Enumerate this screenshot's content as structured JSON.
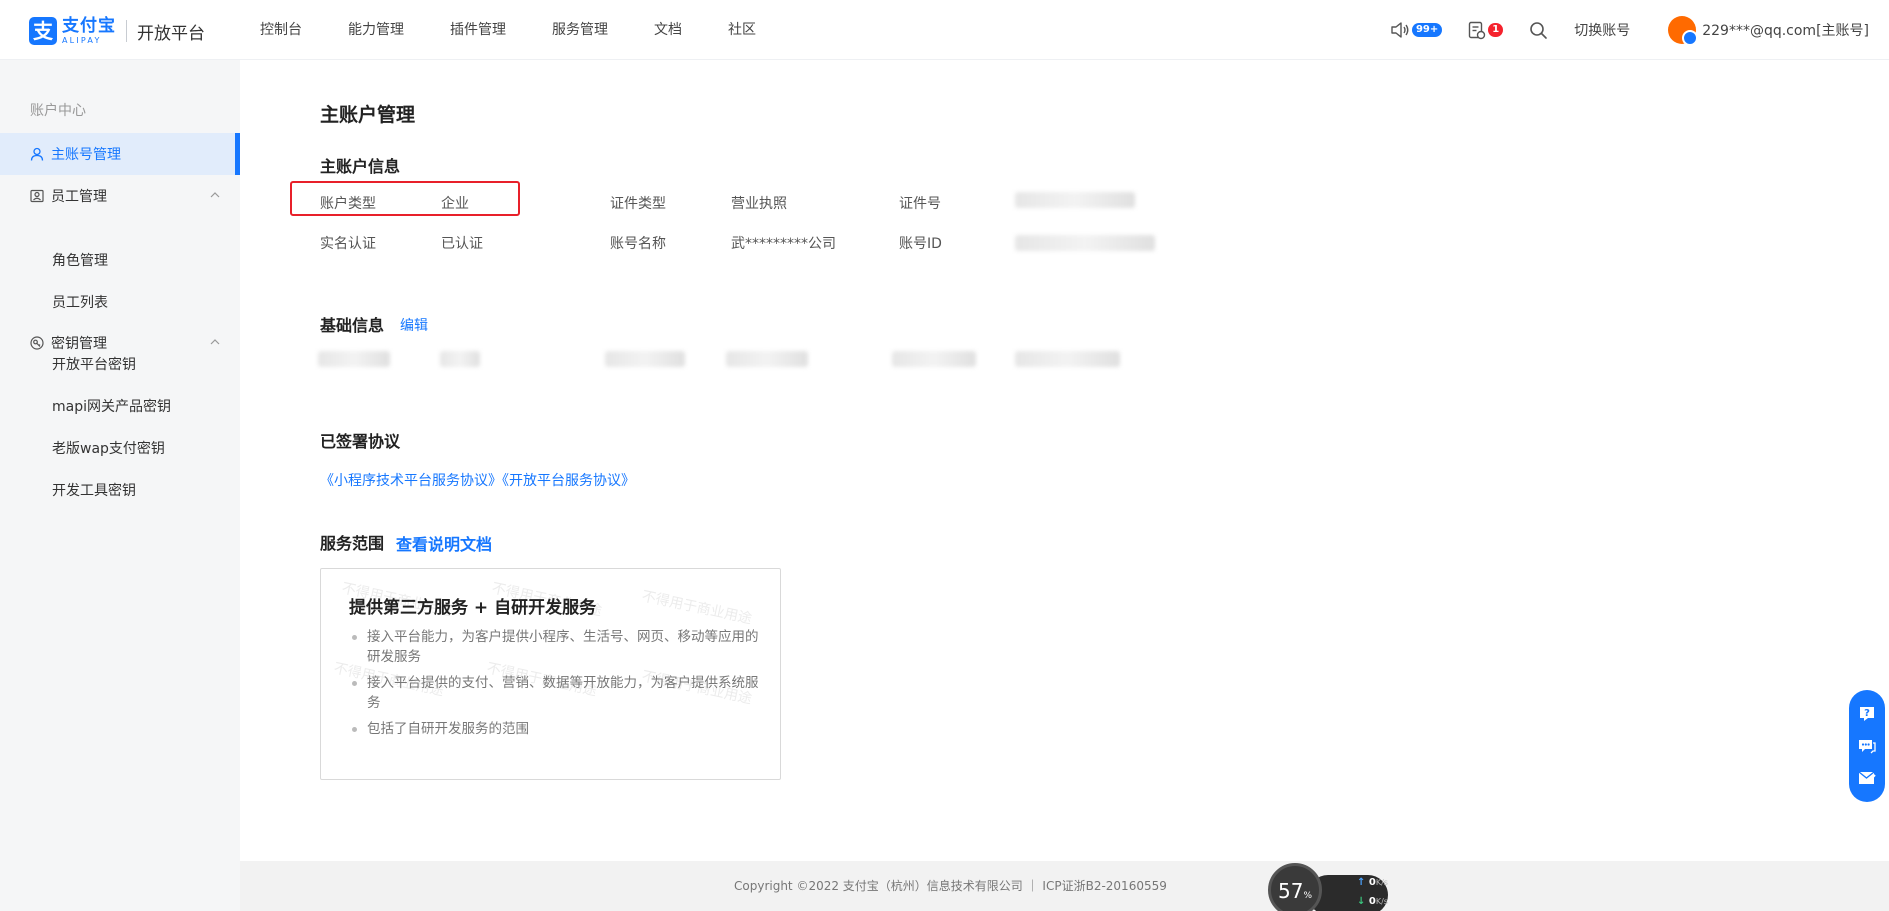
{
  "brand": {
    "mark": "支",
    "name_cn": "支付宝",
    "name_en": "ALIPAY",
    "platform": "开放平台",
    "color": "#1677ff"
  },
  "nav": {
    "items": [
      "控制台",
      "能力管理",
      "插件管理",
      "服务管理",
      "文档",
      "社区"
    ]
  },
  "header_tools": {
    "notify_badge": "99+",
    "task_badge": "1",
    "switch_account": "切换账号",
    "account": "229***@qq.com[主账号]"
  },
  "sidebar": {
    "title": "账户中心",
    "main_account": "主账号管理",
    "staff": "员工管理",
    "role_mgmt": "角色管理",
    "staff_list": "员工列表",
    "key_mgmt": "密钥管理",
    "open_key": "开放平台密钥",
    "mapi_key": "mapi网关产品密钥",
    "wap_key": "老版wap支付密钥",
    "devtool_key": "开发工具密钥"
  },
  "main": {
    "page_title": "主账户管理",
    "account_info": {
      "title": "主账户信息",
      "type_label": "账户类型",
      "type_value": "企业",
      "cert_type_label": "证件类型",
      "cert_type_value": "营业执照",
      "cert_no_label": "证件号",
      "verify_label": "实名认证",
      "verify_value": "已认证",
      "name_label": "账号名称",
      "name_value": "武*********公司",
      "id_label": "账号ID"
    },
    "basic_info": {
      "title": "基础信息",
      "edit": "编辑"
    },
    "agreements": {
      "title": "已签署协议",
      "items": [
        "《小程序技术平台服务协议》",
        "《开放平台服务协议》"
      ]
    },
    "service_scope": {
      "title": "服务范围",
      "doc_link": "查看说明文档",
      "card_title": "提供第三方服务 + 自研开发服务",
      "bullets": [
        "接入平台能力，为客户提供小程序、生活号、网页、移动等应用的研发服务",
        "接入平台提供的支付、营销、数据等开放能力，为客户提供系统服务",
        "包括了自研开发服务的范围"
      ],
      "watermark": "不得用于商业用途"
    }
  },
  "footer": {
    "copyright": "Copyright ©2022 支付宝（杭州）信息技术有限公司 ｜ ICP证浙B2-20160559"
  },
  "net_widget": {
    "percent": "57",
    "percent_unit": "%",
    "up_rate": "0",
    "down_rate": "0",
    "rate_unit": "K/s"
  }
}
